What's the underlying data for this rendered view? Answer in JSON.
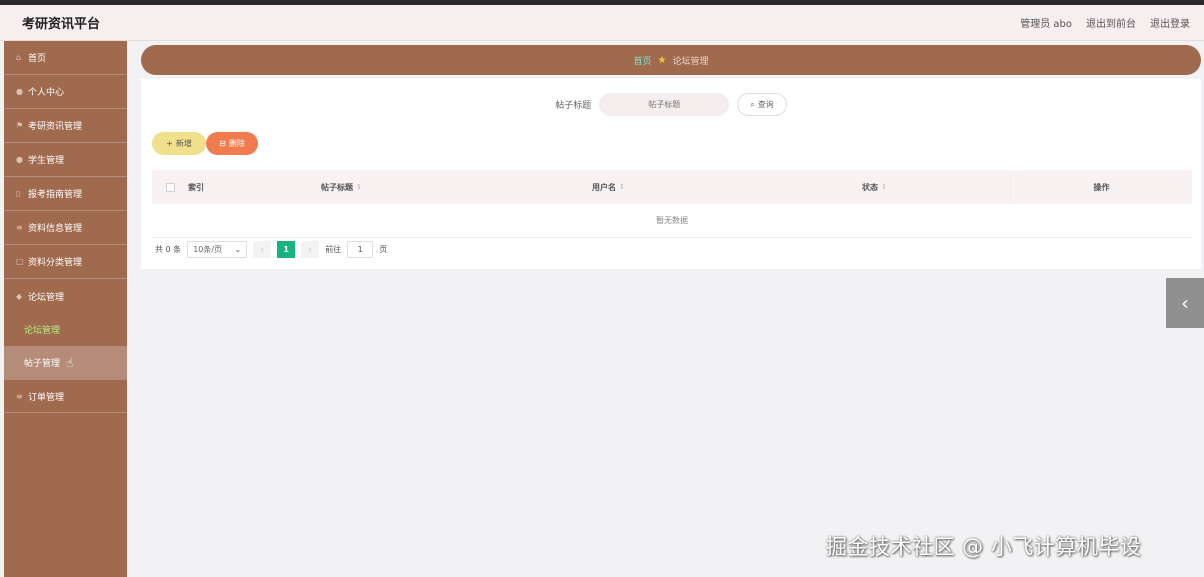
{
  "app": {
    "title": "考研资讯平台"
  },
  "header": {
    "user_label": "管理员 abo",
    "to_frontend": "退出到前台",
    "logout": "退出登录"
  },
  "sidebar": {
    "items": [
      {
        "label": "首页",
        "icon": "home-icon"
      },
      {
        "label": "个人中心",
        "icon": "user-icon"
      },
      {
        "label": "考研资讯管理",
        "icon": "flag-icon"
      },
      {
        "label": "学生管理",
        "icon": "user-icon"
      },
      {
        "label": "报考指南管理",
        "icon": "book-icon"
      },
      {
        "label": "资料信息管理",
        "icon": "doc-icon"
      },
      {
        "label": "资料分类管理",
        "icon": "list-icon"
      },
      {
        "label": "论坛管理",
        "icon": "chat-icon"
      }
    ],
    "sub_items": [
      {
        "label": "论坛管理",
        "state": "active"
      },
      {
        "label": "帖子管理",
        "state": "hover"
      }
    ],
    "last_item": {
      "label": "订单管理",
      "icon": "cart-icon"
    }
  },
  "breadcrumb": {
    "home": "首页",
    "current": "论坛管理"
  },
  "search": {
    "label": "帖子标题",
    "placeholder": "帖子标题",
    "button": "查询"
  },
  "actions": {
    "add": "新增",
    "delete": "删除"
  },
  "table": {
    "columns": [
      "索引",
      "帖子标题",
      "用户名",
      "状态",
      "操作"
    ],
    "empty_text": "暂无数据"
  },
  "pagination": {
    "total": "共 0 条",
    "page_size": "10条/页",
    "current_page": "1",
    "goto_label": "前往",
    "goto_value": "1",
    "page_suffix": "页"
  },
  "watermark": "掘金技术社区 @ 小飞计算机毕设"
}
